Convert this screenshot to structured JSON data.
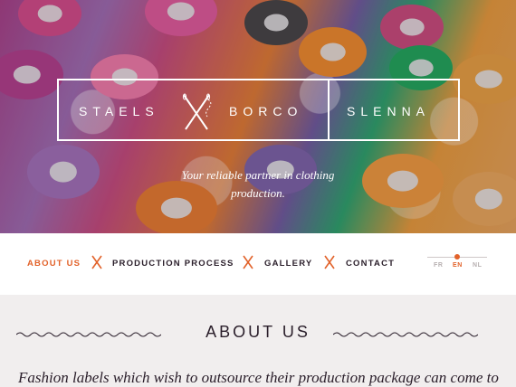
{
  "hero": {
    "brand_left": "STAELS",
    "brand_middle": "BORCO",
    "brand_right": "SLENNA",
    "tagline_line1": "Your reliable partner in clothing",
    "tagline_line2": "production."
  },
  "nav": {
    "items": [
      {
        "label": "ABOUT US"
      },
      {
        "label": "PRODUCTION PROCESS"
      },
      {
        "label": "GALLERY"
      },
      {
        "label": "CONTACT"
      }
    ],
    "languages": [
      {
        "label": "FR"
      },
      {
        "label": "EN"
      },
      {
        "label": "NL"
      }
    ],
    "separator_icon": "cross-stitch-icon"
  },
  "about": {
    "title": "ABOUT US",
    "intro": "Fashion labels which wish to outsource their production package can come to"
  },
  "colors": {
    "accent": "#e2622a",
    "text_dark": "#2a1e2a",
    "section_bg": "#f1eeee",
    "nav_bg": "#ffffff"
  }
}
